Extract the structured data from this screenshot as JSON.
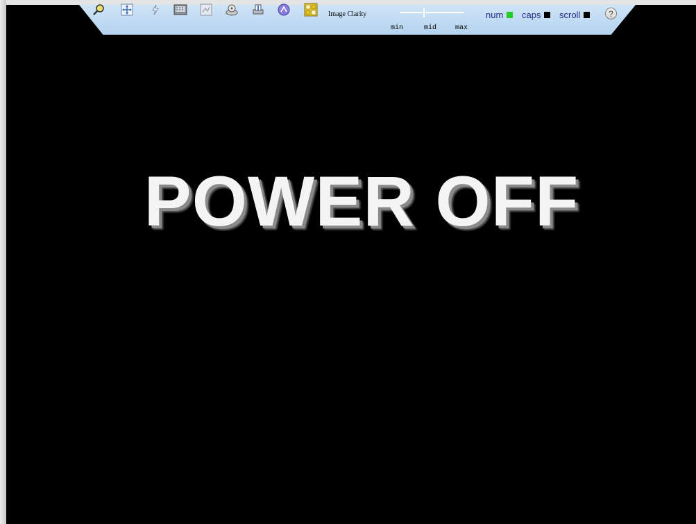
{
  "toolbar": {
    "clarity_label": "Image Clarity",
    "slider_ticks": {
      "min": "min",
      "mid": "mid",
      "max": "max"
    },
    "slider_value": 0.4,
    "locks": {
      "num_label": "num",
      "num_color": "#22cc22",
      "caps_label": "caps",
      "caps_color": "#000000",
      "scroll_label": "scroll",
      "scroll_color": "#000000"
    },
    "help_label": "?",
    "icons": [
      "connect-icon",
      "fit-screen-icon",
      "lightning-icon",
      "keyboard-icon",
      "screenshot-icon",
      "virtual-media-icon",
      "print-icon",
      "color-icon",
      "mouse-sync-icon"
    ]
  },
  "screen": {
    "message": "POWER OFF",
    "background": "#000000",
    "text_color": "#f4f4f4"
  }
}
